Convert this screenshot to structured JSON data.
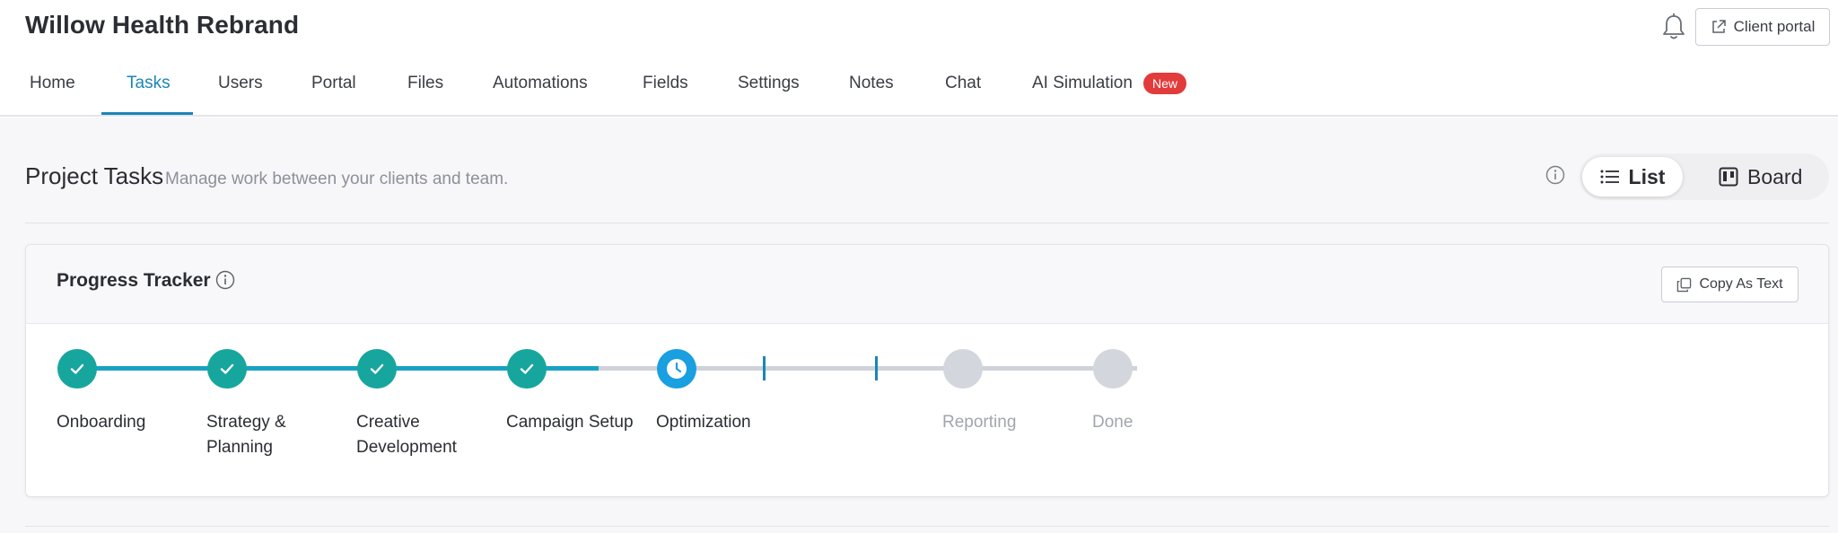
{
  "app": {
    "title": "Willow Health Rebrand"
  },
  "header": {
    "client_portal_label": "Client portal",
    "notifications_icon": "bell-icon"
  },
  "nav": {
    "items": [
      {
        "label": "Home"
      },
      {
        "label": "Tasks",
        "active": true
      },
      {
        "label": "Users"
      },
      {
        "label": "Portal"
      },
      {
        "label": "Files"
      },
      {
        "label": "Automations"
      },
      {
        "label": "Fields"
      },
      {
        "label": "Settings"
      },
      {
        "label": "Notes"
      },
      {
        "label": "Chat"
      },
      {
        "label": "AI Simulation",
        "badge": "New"
      }
    ]
  },
  "page": {
    "title": "Project Tasks",
    "subtitle": "Manage work between your clients and team.",
    "view_toggle": {
      "list_label": "List",
      "board_label": "Board",
      "selected": "List"
    }
  },
  "tracker": {
    "title": "Progress Tracker",
    "copy_label": "Copy As Text",
    "steps": [
      {
        "label": "Onboarding",
        "status": "done"
      },
      {
        "label": "Strategy & Planning",
        "status": "done"
      },
      {
        "label": "Creative Development",
        "status": "done"
      },
      {
        "label": "Campaign Setup",
        "status": "done"
      },
      {
        "label": "Optimization",
        "status": "current"
      },
      {
        "label": "Reporting",
        "status": "todo"
      },
      {
        "label": "Done",
        "status": "todo"
      }
    ]
  },
  "colors": {
    "accent": "#1a86b8",
    "done": "#17a69d",
    "current": "#1a9fe0",
    "todo": "#d3d6dc",
    "badge": "#e23b3b"
  }
}
